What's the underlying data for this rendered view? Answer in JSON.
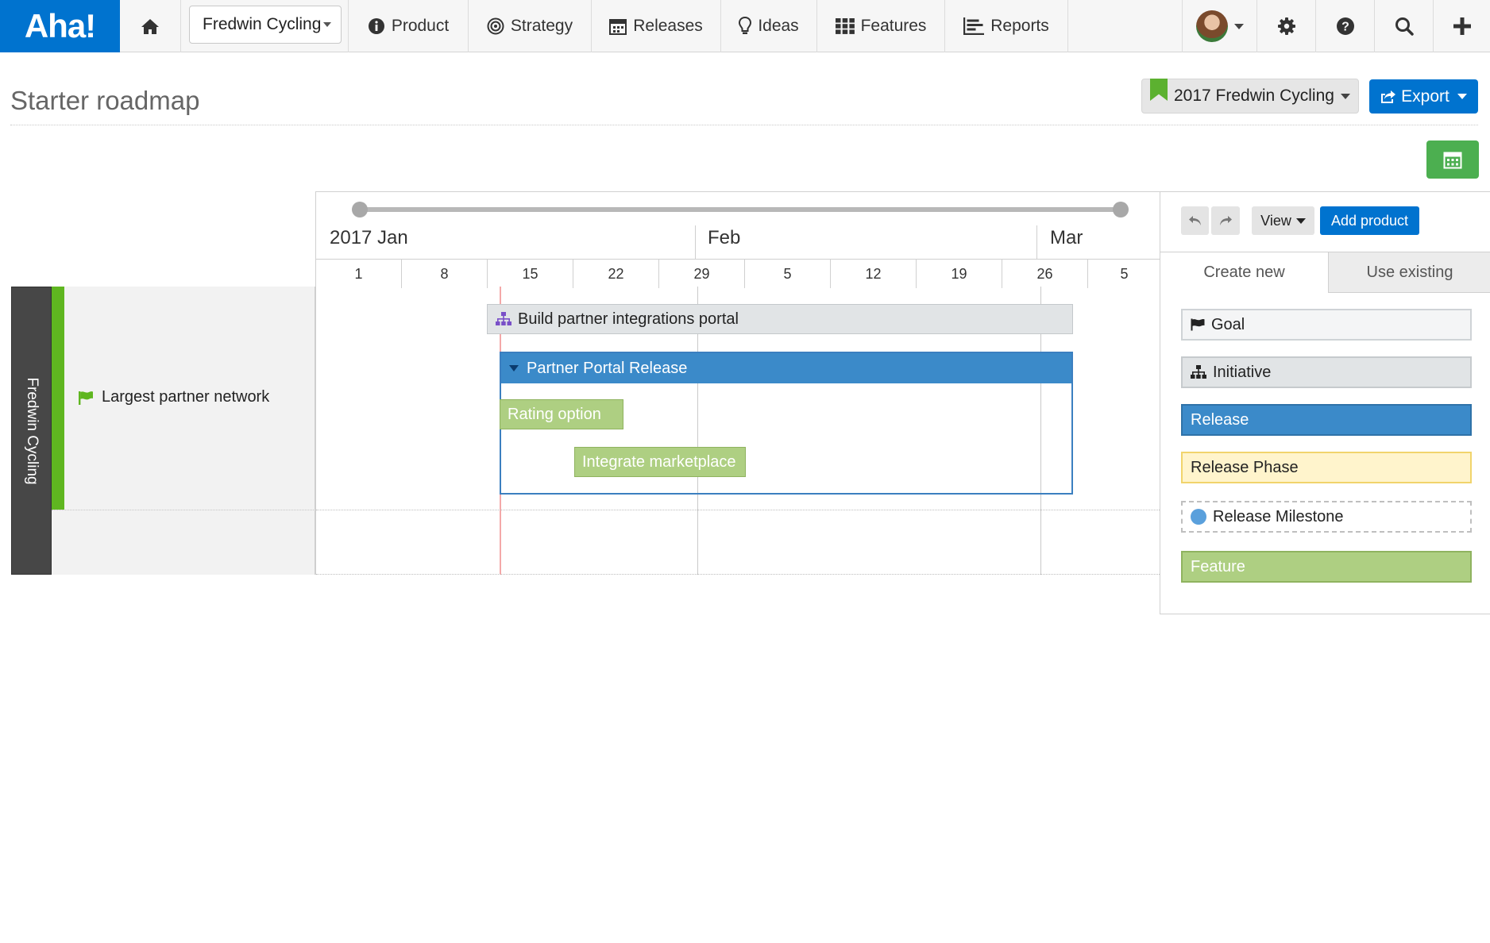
{
  "nav": {
    "logo": "Aha!",
    "product_select": "Fredwin Cycling",
    "items": [
      {
        "label": "Product",
        "icon": "info-circle-icon"
      },
      {
        "label": "Strategy",
        "icon": "target-icon"
      },
      {
        "label": "Releases",
        "icon": "calendar-icon"
      },
      {
        "label": "Ideas",
        "icon": "lightbulb-icon"
      },
      {
        "label": "Features",
        "icon": "grid-icon"
      },
      {
        "label": "Reports",
        "icon": "report-icon"
      }
    ]
  },
  "header": {
    "title": "Starter roadmap",
    "roadmap_select": "2017 Fredwin Cycling",
    "export_label": "Export"
  },
  "timeline": {
    "months": [
      "2017 Jan",
      "Feb",
      "Mar"
    ],
    "weeks": [
      "1",
      "8",
      "15",
      "22",
      "29",
      "5",
      "12",
      "19",
      "26",
      "5"
    ]
  },
  "swimlane": {
    "product": "Fredwin Cycling",
    "goal": "Largest partner network"
  },
  "roadmap": {
    "initiative": "Build partner integrations portal",
    "release": "Partner Portal Release",
    "features": [
      "Rating option",
      "Integrate marketplace"
    ]
  },
  "panel": {
    "view_label": "View",
    "add_product_label": "Add product",
    "tabs": [
      "Create new",
      "Use existing"
    ],
    "cards": {
      "goal": "Goal",
      "initiative": "Initiative",
      "release": "Release",
      "release_phase": "Release Phase",
      "release_milestone": "Release Milestone",
      "feature": "Feature"
    }
  },
  "colors": {
    "brand": "#0073cf",
    "goal_green": "#5fb620",
    "release_blue": "#3b8ac9",
    "feature_green": "#aecf82",
    "initiative_gray": "#e1e4e6",
    "phase_yellow": "#fff4cc"
  }
}
